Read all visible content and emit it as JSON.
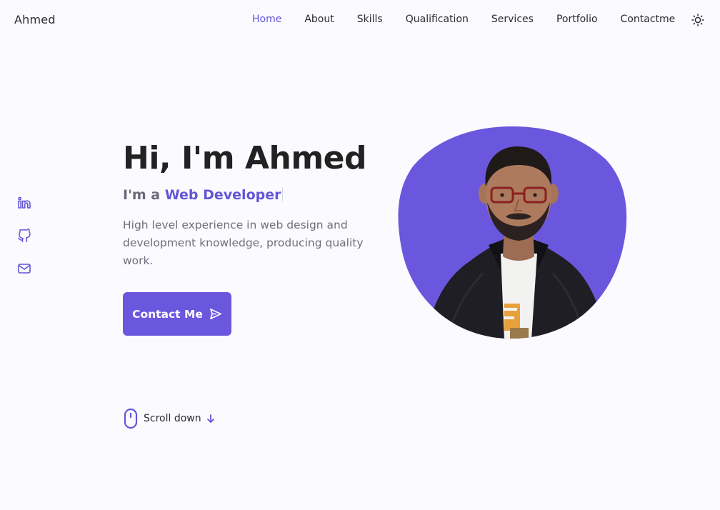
{
  "header": {
    "logo": "Ahmed",
    "nav": [
      {
        "label": "Home",
        "active": true
      },
      {
        "label": "About"
      },
      {
        "label": "Skills"
      },
      {
        "label": "Qualification"
      },
      {
        "label": "Services"
      },
      {
        "label": "Portfolio"
      },
      {
        "label": "Contactme"
      }
    ],
    "theme_icon": "sun-icon"
  },
  "social": {
    "items": [
      {
        "icon": "linkedin-icon"
      },
      {
        "icon": "github-icon"
      },
      {
        "icon": "mail-icon"
      }
    ]
  },
  "hero": {
    "title": "Hi, I'm Ahmed",
    "subtitle_prefix": "I'm a ",
    "subtitle_role": "Web Developer",
    "description": "High level experience in web design and development knowledge, producing quality work.",
    "button_label": "Contact Me",
    "button_icon": "send-icon",
    "image": "profile-photo"
  },
  "scroll": {
    "label": "Scroll down",
    "mouse_icon": "mouse-icon",
    "arrow_icon": "arrow-down-icon"
  },
  "colors": {
    "accent": "#6b57dd",
    "background": "#fbfaff",
    "text": "#222222",
    "muted": "#706e7c"
  }
}
